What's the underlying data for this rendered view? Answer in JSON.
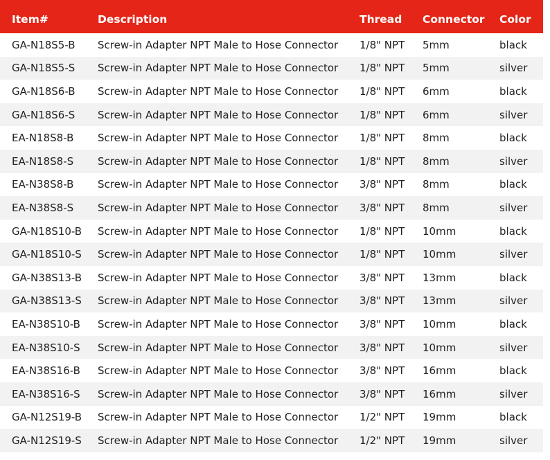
{
  "table": {
    "headers": {
      "item": "Item#",
      "description": "Description",
      "thread": "Thread",
      "connector": "Connector",
      "color": "Color"
    },
    "rows": [
      {
        "item": "GA-N18S5-B",
        "description": "Screw-in Adapter NPT Male to Hose Connector",
        "thread": "1/8\" NPT",
        "connector": "5mm",
        "color": "black"
      },
      {
        "item": "GA-N18S5-S",
        "description": "Screw-in Adapter NPT Male to Hose Connector",
        "thread": "1/8\" NPT",
        "connector": "5mm",
        "color": "silver"
      },
      {
        "item": "GA-N18S6-B",
        "description": "Screw-in Adapter NPT Male to Hose Connector",
        "thread": "1/8\" NPT",
        "connector": "6mm",
        "color": "black"
      },
      {
        "item": "GA-N18S6-S",
        "description": "Screw-in Adapter NPT Male to Hose Connector",
        "thread": "1/8\" NPT",
        "connector": "6mm",
        "color": "silver"
      },
      {
        "item": "EA-N18S8-B",
        "description": "Screw-in Adapter NPT Male to Hose Connector",
        "thread": "1/8\" NPT",
        "connector": "8mm",
        "color": "black"
      },
      {
        "item": "EA-N18S8-S",
        "description": "Screw-in Adapter NPT Male to Hose Connector",
        "thread": "1/8\" NPT",
        "connector": "8mm",
        "color": "silver"
      },
      {
        "item": "EA-N38S8-B",
        "description": "Screw-in Adapter NPT Male to Hose Connector",
        "thread": "3/8\" NPT",
        "connector": "8mm",
        "color": "black"
      },
      {
        "item": "EA-N38S8-S",
        "description": "Screw-in Adapter NPT Male to Hose Connector",
        "thread": "3/8\" NPT",
        "connector": "8mm",
        "color": "silver"
      },
      {
        "item": "GA-N18S10-B",
        "description": "Screw-in Adapter NPT Male to Hose Connector",
        "thread": "1/8\" NPT",
        "connector": "10mm",
        "color": "black"
      },
      {
        "item": "GA-N18S10-S",
        "description": "Screw-in Adapter NPT Male to Hose Connector",
        "thread": "1/8\" NPT",
        "connector": "10mm",
        "color": "silver"
      },
      {
        "item": "GA-N38S13-B",
        "description": "Screw-in Adapter NPT Male to Hose Connector",
        "thread": "3/8\" NPT",
        "connector": "13mm",
        "color": "black"
      },
      {
        "item": "GA-N38S13-S",
        "description": "Screw-in Adapter NPT Male to Hose Connector",
        "thread": "3/8\" NPT",
        "connector": "13mm",
        "color": "silver"
      },
      {
        "item": "EA-N38S10-B",
        "description": "Screw-in Adapter NPT Male to Hose Connector",
        "thread": "3/8\" NPT",
        "connector": "10mm",
        "color": "black"
      },
      {
        "item": "EA-N38S10-S",
        "description": "Screw-in Adapter NPT Male to Hose Connector",
        "thread": "3/8\" NPT",
        "connector": "10mm",
        "color": "silver"
      },
      {
        "item": "EA-N38S16-B",
        "description": "Screw-in Adapter NPT Male to Hose Connector",
        "thread": "3/8\" NPT",
        "connector": "16mm",
        "color": "black"
      },
      {
        "item": "EA-N38S16-S",
        "description": "Screw-in Adapter NPT Male to Hose Connector",
        "thread": "3/8\" NPT",
        "connector": "16mm",
        "color": "silver"
      },
      {
        "item": "GA-N12S19-B",
        "description": "Screw-in Adapter NPT Male to Hose Connector",
        "thread": "1/2\" NPT",
        "connector": "19mm",
        "color": "black"
      },
      {
        "item": "GA-N12S19-S",
        "description": "Screw-in Adapter NPT Male to Hose Connector",
        "thread": "1/2\" NPT",
        "connector": "19mm",
        "color": "silver"
      }
    ]
  },
  "colors": {
    "header_background": "#e42517",
    "header_text": "#ffffff",
    "stripe": "#f2f2f2"
  }
}
